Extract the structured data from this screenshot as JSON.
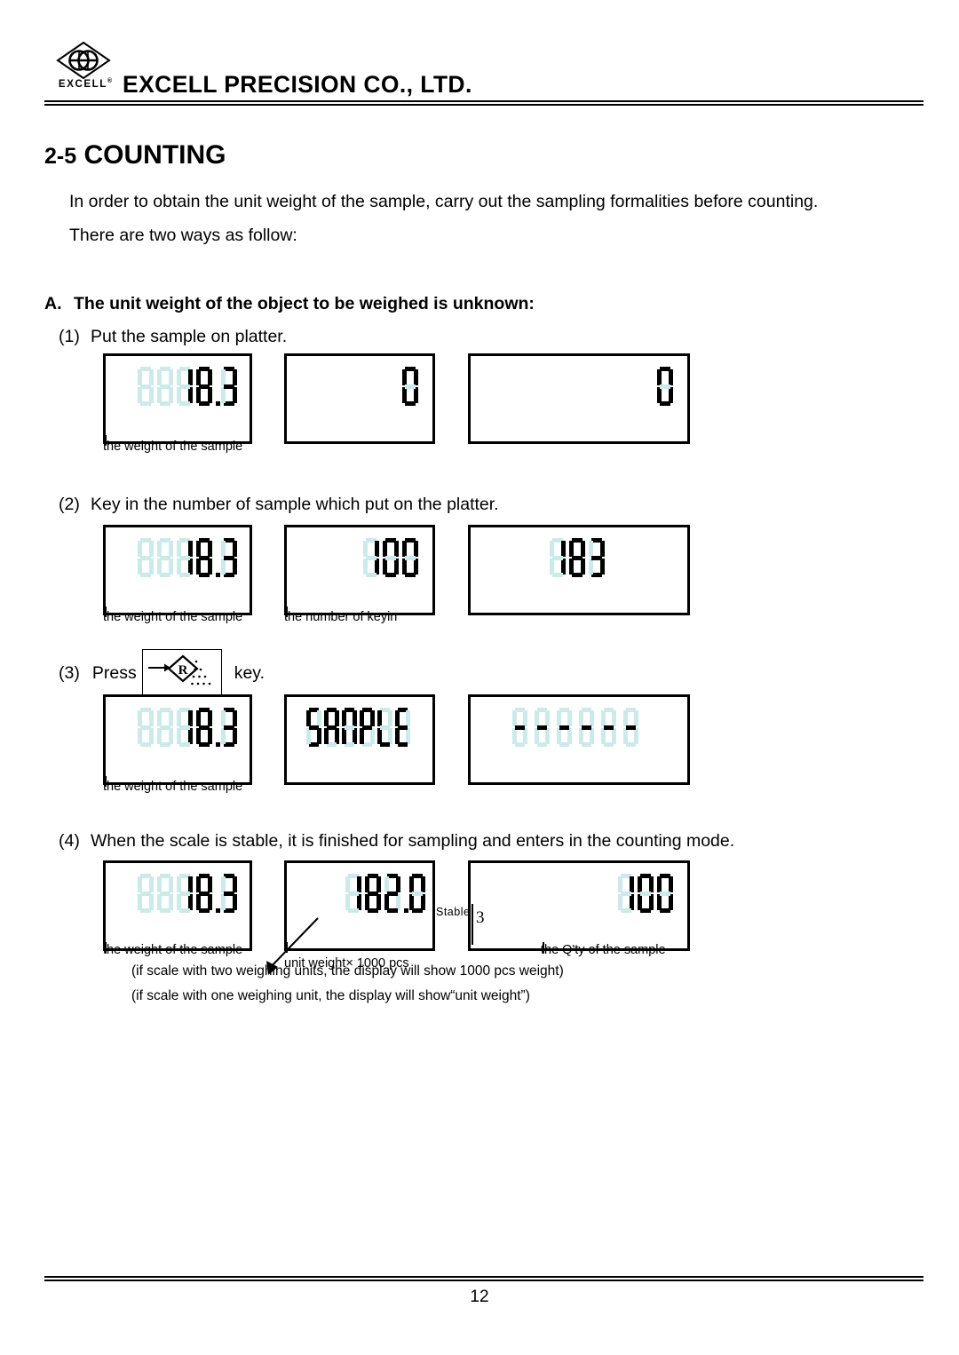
{
  "header": {
    "company": "EXCELL PRECISION CO., LTD.",
    "logo_text": "EXCELL",
    "logo_registered": "®",
    "logo_mark": "diamond-ee-logo"
  },
  "section": {
    "number": "2-5",
    "title": "COUNTING",
    "intro_line1": "In order to obtain the unit weight of the sample, carry out the sampling formalities before counting.",
    "intro_line2": "There are two ways as follow:",
    "subsection_label": "A.",
    "subsection_title": "The unit weight of the object to be weighed is unknown:"
  },
  "steps": [
    {
      "number": "(1)",
      "text": "Put the sample on platter."
    },
    {
      "number": "(2)",
      "text": "Key in the number of sample which put on the platter."
    },
    {
      "number": "(3)",
      "text_before": "Press",
      "text_after": "key.",
      "key_icon": "sample-r-key"
    },
    {
      "number": "(4)",
      "text": "When the scale is stable, it is finished for sampling and enters in the counting mode."
    }
  ],
  "rows": [
    {
      "name": "step1-displays",
      "displays": [
        {
          "name": "weight-display",
          "value": "18.3",
          "digits": "  18.3",
          "caption": "the weight of the sample"
        },
        {
          "name": "keyin-display",
          "value": "0",
          "digits": "0",
          "caption": ""
        },
        {
          "name": "qty-display",
          "value": "0",
          "digits": "0",
          "caption": ""
        }
      ]
    },
    {
      "name": "step2-displays",
      "displays": [
        {
          "name": "weight-display",
          "value": "18.3",
          "digits": "  18.3",
          "caption": "the weight of the sample"
        },
        {
          "name": "keyin-display",
          "value": "100",
          "digits": "100",
          "caption": "the number of keyin"
        },
        {
          "name": "qty-display",
          "value": "183",
          "digits": "183",
          "caption": ""
        }
      ]
    },
    {
      "name": "step3-displays",
      "displays": [
        {
          "name": "weight-display",
          "value": "18.3",
          "digits": "  18.3",
          "caption": "the weight of the sample"
        },
        {
          "name": "sample-text-display",
          "value": "SAMPLE",
          "digits": "SAMPLE",
          "caption": ""
        },
        {
          "name": "dashes-display",
          "value": "------",
          "digits": "------",
          "caption": ""
        }
      ]
    },
    {
      "name": "step4-displays",
      "displays": [
        {
          "name": "weight-display",
          "value": "18.3",
          "digits": "  18.3",
          "caption": "the weight of the sample"
        },
        {
          "name": "unit-weight-display",
          "value": "182.0",
          "digits": "182.0",
          "caption": "unit weight× 1000 pcs"
        },
        {
          "name": "qty-display",
          "value": "100",
          "digits": "100",
          "caption": "the Q'ty of the sample"
        }
      ]
    }
  ],
  "stable_indicator": {
    "label": "Stable",
    "value": "3"
  },
  "notes": [
    "(if scale with two weighing units, the display will show 1000 pcs weight)",
    "(if scale with one weighing unit, the display will show“unit weight”)"
  ],
  "footer": {
    "page_number": "12"
  },
  "colors": {
    "segment_on": "#000000",
    "segment_off": "#cdeaea",
    "border": "#000000",
    "background": "#ffffff"
  }
}
